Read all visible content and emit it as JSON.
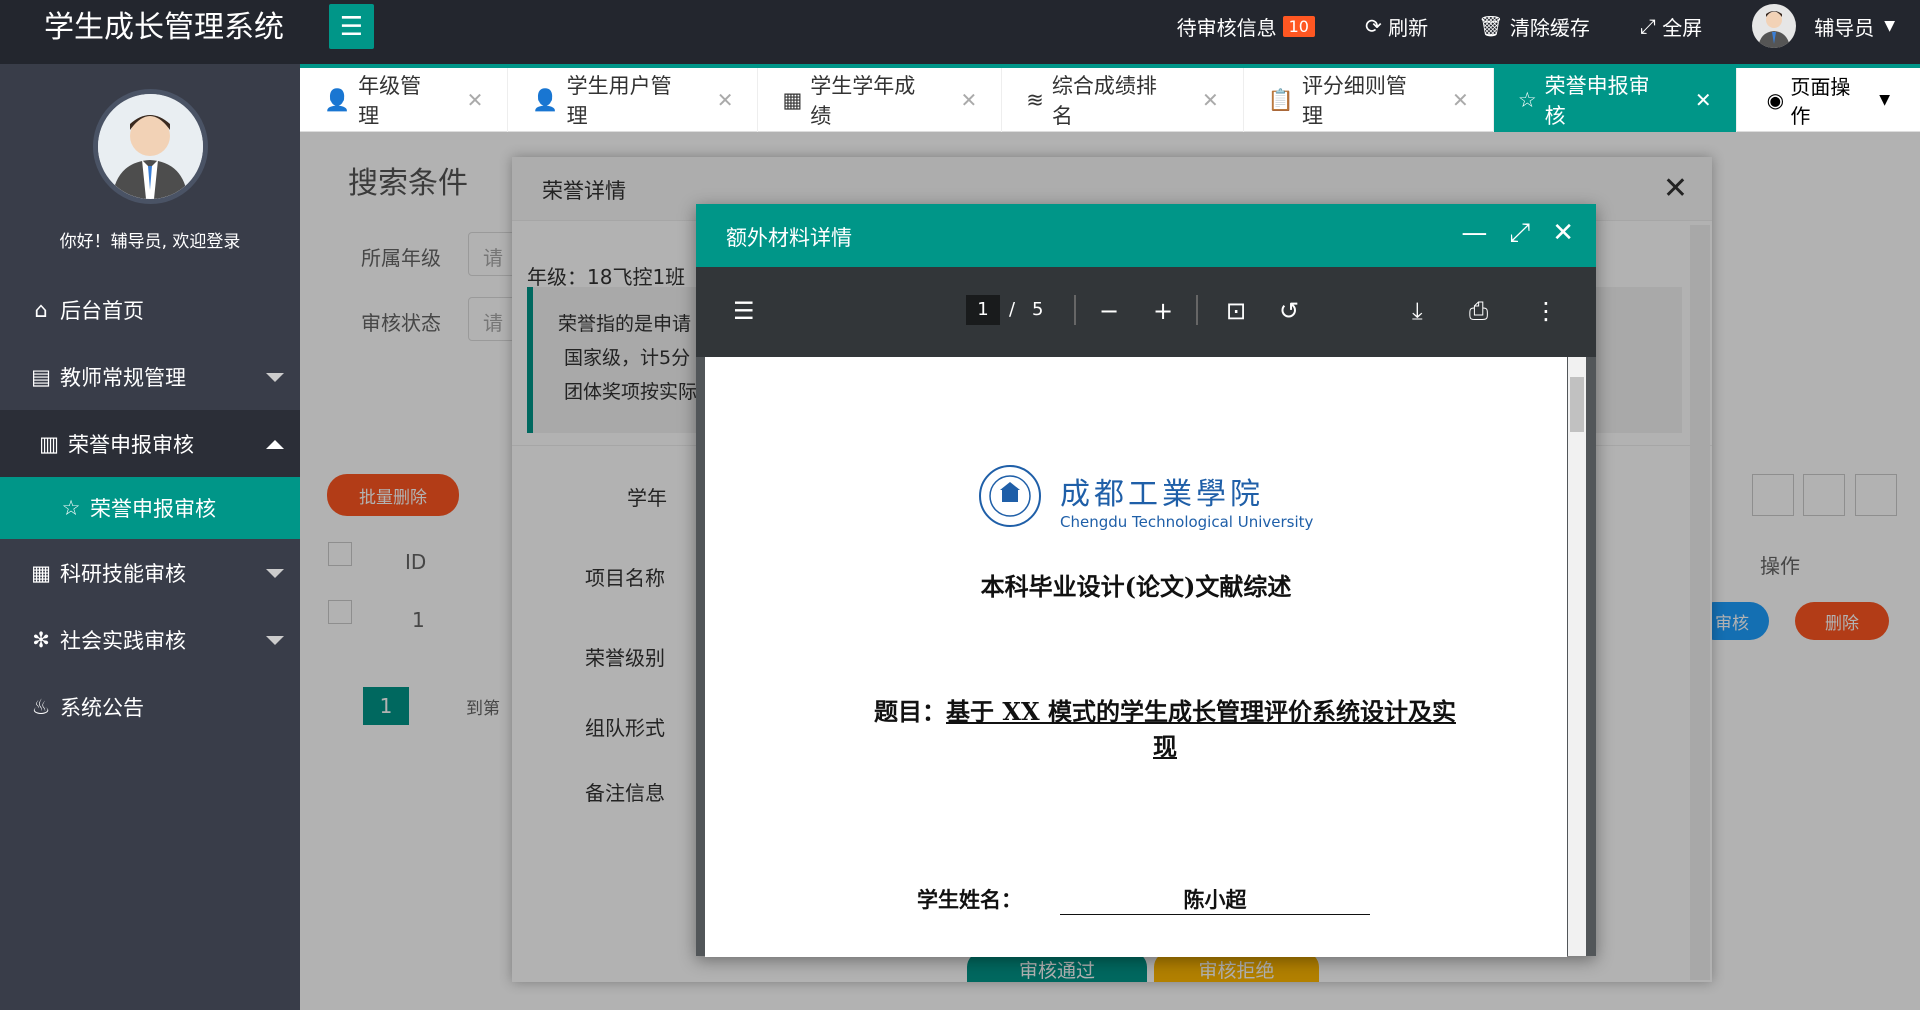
{
  "app": {
    "title": "学生成长管理系统"
  },
  "topnav": {
    "pending_label": "待审核信息",
    "pending_count": "10",
    "refresh": "刷新",
    "clear_cache": "清除缓存",
    "fullscreen": "全屏",
    "user": "辅导员"
  },
  "sidebar": {
    "welcome": "你好！辅导员, 欢迎登录",
    "items": [
      {
        "label": "后台首页"
      },
      {
        "label": "教师常规管理"
      },
      {
        "label": "荣誉申报审核"
      },
      {
        "label": "荣誉申报审核"
      },
      {
        "label": "科研技能审核"
      },
      {
        "label": "社会实践审核"
      },
      {
        "label": "系统公告"
      }
    ]
  },
  "tabs": [
    {
      "label": "年级管理"
    },
    {
      "label": "学生用户管理"
    },
    {
      "label": "学生学年成绩"
    },
    {
      "label": "综合成绩排名"
    },
    {
      "label": "评分细则管理"
    },
    {
      "label": "荣誉申报审核"
    }
  ],
  "page_ops": "页面操作",
  "search": {
    "title": "搜索条件",
    "grade_label": "所属年级",
    "status_label": "审核状态",
    "placeholder": "请"
  },
  "table": {
    "batch_delete": "批量删除",
    "col_id": "ID",
    "col_ops": "操作",
    "row_id": "1",
    "review": "审核",
    "delete": "删除",
    "page": "1",
    "goto": "到第"
  },
  "honor_dialog": {
    "title": "荣誉详情",
    "grade": "年级：18飞控1班",
    "note1": "荣誉指的是申请",
    "note2": "国家级，计5分",
    "note3": "团体奖项按实际",
    "fields": [
      "学年",
      "项目名称",
      "荣誉级别",
      "组队形式",
      "备注信息"
    ],
    "approve": "审核通过",
    "reject": "审核拒绝"
  },
  "material_dialog": {
    "title": "额外材料详情"
  },
  "pdf": {
    "page": "1",
    "total": "5",
    "school_cn": "成都工業學院",
    "school_en": "Chengdu Technological University",
    "doc_title": "本科毕业设计(论文)文献综述",
    "topic_label": "题目：",
    "topic": "基于 XX 模式的学生成长管理评价系统设计及实现",
    "name_label": "学生姓名：",
    "name": "陈小超"
  },
  "colors": {
    "primary": "#009688",
    "danger": "#ff5722",
    "warn": "#ffb800",
    "topbar": "#23262e",
    "sidebar": "#393d49"
  }
}
